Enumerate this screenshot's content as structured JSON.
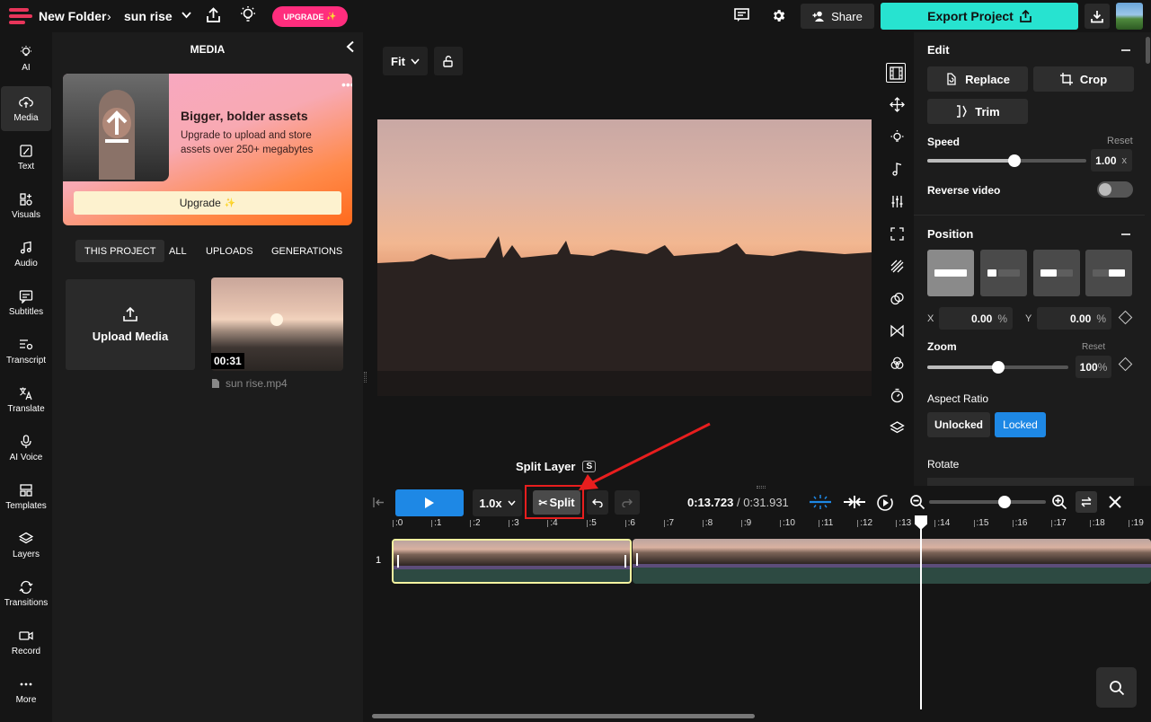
{
  "topbar": {
    "folder": "New Folder",
    "project": "sun rise",
    "upgrade_label": "UPGRADE",
    "share_label": "Share",
    "export_label": "Export Project"
  },
  "nav": [
    {
      "label": "AI",
      "icon": "bulb-icon"
    },
    {
      "label": "Media",
      "icon": "upload-cloud-icon"
    },
    {
      "label": "Text",
      "icon": "text-edit-icon"
    },
    {
      "label": "Visuals",
      "icon": "shapes-icon"
    },
    {
      "label": "Audio",
      "icon": "music-icon"
    },
    {
      "label": "Subtitles",
      "icon": "subtitles-icon"
    },
    {
      "label": "Transcript",
      "icon": "transcript-icon"
    },
    {
      "label": "Translate",
      "icon": "translate-icon"
    },
    {
      "label": "AI Voice",
      "icon": "ai-voice-icon"
    },
    {
      "label": "Templates",
      "icon": "templates-icon"
    },
    {
      "label": "Layers",
      "icon": "layers-icon"
    },
    {
      "label": "Transitions",
      "icon": "transitions-icon"
    },
    {
      "label": "Record",
      "icon": "record-icon"
    },
    {
      "label": "More",
      "icon": "more-icon"
    }
  ],
  "media": {
    "title": "MEDIA",
    "promo_title": "Bigger, bolder assets",
    "promo_desc": "Upgrade to upload and store assets over 250+ megabytes",
    "promo_button": "Upgrade",
    "tabs": [
      "THIS PROJECT",
      "ALL",
      "UPLOADS",
      "GENERATIONS"
    ],
    "upload_label": "Upload Media",
    "file_duration": "00:31",
    "file_name": "sun rise.mp4"
  },
  "preview": {
    "fit_label": "Fit"
  },
  "props": {
    "edit_title": "Edit",
    "replace_label": "Replace",
    "crop_label": "Crop",
    "trim_label": "Trim",
    "speed_label": "Speed",
    "speed_reset": "Reset",
    "speed_value": "1.00",
    "speed_unit": "x",
    "speed_fraction": 0.55,
    "reverse_label": "Reverse video",
    "position_title": "Position",
    "x_label": "X",
    "x_value": "0.00",
    "x_unit": "%",
    "y_label": "Y",
    "y_value": "0.00",
    "y_unit": "%",
    "zoom_label": "Zoom",
    "zoom_reset": "Reset",
    "zoom_value": "100",
    "zoom_unit": "%",
    "zoom_fraction": 0.5,
    "aspect_label": "Aspect Ratio",
    "aspect_unlocked": "Unlocked",
    "aspect_locked": "Locked",
    "rotate_label": "Rotate"
  },
  "timeline": {
    "speed": "1.0x",
    "split_label": "Split",
    "tooltip": "Split Layer",
    "tooltip_key": "S",
    "current_time": "0:13.723",
    "total_time": "0:31.931",
    "track_number": "1",
    "ticks": [
      ":0",
      ":1",
      ":2",
      ":3",
      ":4",
      ":5",
      ":6",
      ":7",
      ":8",
      ":9",
      ":10",
      ":11",
      ":12",
      ":13",
      ":14",
      ":15",
      ":16",
      ":17",
      ":18",
      ":19"
    ]
  },
  "colors": {
    "accent_export": "#27e3d0",
    "accent_upgrade": "#ff2d7d",
    "play_blue": "#1e88e5",
    "split_highlight": "#e81e1e",
    "locked_blue": "#1e88e5"
  }
}
